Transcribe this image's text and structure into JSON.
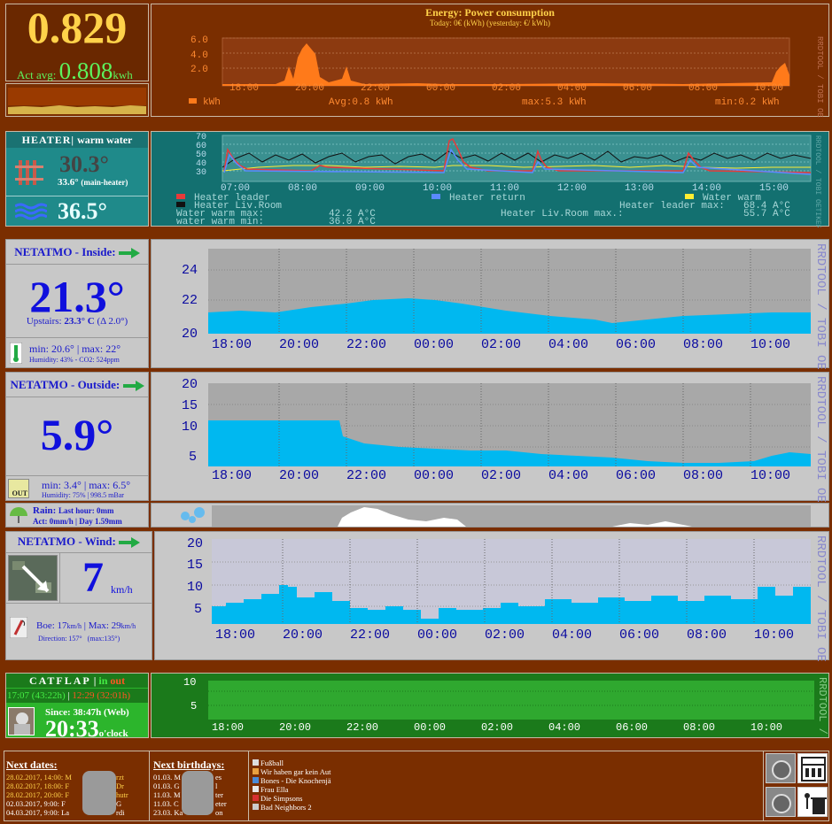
{
  "energy": {
    "current": "0.829",
    "avg_label": "Act avg:",
    "avg_value": "0.808",
    "avg_unit": "kwh",
    "graph_title": "Energy: Power consumption",
    "graph_sub": "Today: 0€ (kWh) (yesterday: €/ kWh)",
    "y_ticks": [
      "6.0",
      "4.0",
      "2.0"
    ],
    "x_ticks": [
      "18:00",
      "20:00",
      "22:00",
      "00:00",
      "02:00",
      "04:00",
      "06:00",
      "08:00",
      "10:00"
    ],
    "legend_kwh": "kWh",
    "legend_avg": "Avg:0.8 kWh",
    "legend_max": "max:5.3 kWh",
    "legend_min": "min:0.2 kWh",
    "watermark": "RRDTOOL / TOBI OETIKER",
    "color": "#ff7a1a"
  },
  "heater": {
    "title": "HEATER",
    "subtitle": "warm water",
    "temp1": "30.3°",
    "temp1_sub": "33.6°",
    "temp1_sub_note": "(main-heater)",
    "temp2": "36.5°",
    "y_ticks": [
      "70",
      "60",
      "50",
      "40",
      "30"
    ],
    "x_ticks": [
      "07:00",
      "08:00",
      "09:00",
      "10:00",
      "11:00",
      "12:00",
      "13:00",
      "14:00",
      "15:00"
    ],
    "legend": [
      {
        "label": "Heater leader",
        "color": "#e83a3a"
      },
      {
        "label": "Heater return",
        "color": "#5a8aff"
      },
      {
        "label": "Water warm",
        "color": "#ffee33"
      },
      {
        "label": "Heater Liv.Room",
        "color": "#111111"
      }
    ],
    "stat_rows": [
      [
        "Heater leader max:",
        "68.4 A°C"
      ],
      [
        "Water warm max:",
        "42.2 A°C"
      ],
      [
        "Heater Liv.Room max.:",
        "55.7 A°C"
      ],
      [
        "water warm min:",
        "36.0 A°C"
      ]
    ],
    "watermark": "RRDTOOL / TOBI OETIKER"
  },
  "inside": {
    "title": "NETATMO - Inside:",
    "temp": "21.3°",
    "upstairs_label": "Upstairs:",
    "upstairs_val": "23.3° C",
    "upstairs_delta": "(Δ 2.0°)",
    "min": "min: 20.6°",
    "max": "max: 22°",
    "humidity": "Humidity: 43%",
    "co2": "CO2: 524ppm",
    "y_ticks": [
      "24",
      "22",
      "20"
    ],
    "x_ticks": [
      "18:00",
      "20:00",
      "22:00",
      "00:00",
      "02:00",
      "04:00",
      "06:00",
      "08:00",
      "10:00"
    ],
    "watermark": "RRDTOOL / TOBI OETIKER"
  },
  "outside": {
    "title": "NETATMO - Outside:",
    "temp": "5.9°",
    "min": "min: 3.4°",
    "max": "max: 6.5°",
    "humidity": "Humidity: 75%",
    "pressure": "998.5 mBar",
    "icon_label": "OUT",
    "y_ticks": [
      "20",
      "15",
      "10",
      "5"
    ],
    "x_ticks": [
      "18:00",
      "20:00",
      "22:00",
      "00:00",
      "02:00",
      "04:00",
      "06:00",
      "08:00",
      "10:00"
    ],
    "watermark": "RRDTOOL / TOBI OETIKER"
  },
  "rain": {
    "label": "Rain:",
    "last_hour": "Last hour: 0mm",
    "act": "Act: 0mm/h",
    "day": "Day 1.59mm"
  },
  "wind": {
    "title": "NETATMO - Wind:",
    "speed": "7",
    "unit": "km/h",
    "boe_label": "Boe:",
    "boe_val": "17",
    "boe_unit": "km/h",
    "max_label": "Max:",
    "max_val": "29",
    "max_unit": "km/h",
    "direction": "Direction: 157°",
    "max_dir": "(max:135°)",
    "y_ticks": [
      "20",
      "15",
      "10",
      "5"
    ],
    "x_ticks": [
      "18:00",
      "20:00",
      "22:00",
      "00:00",
      "02:00",
      "04:00",
      "06:00",
      "08:00",
      "10:00"
    ],
    "watermark": "RRDTOOL / TOBI OETIKER"
  },
  "catflap": {
    "title": "CATFLAP",
    "sep": "|",
    "in": "in",
    "out": "out",
    "in_time": "17:07 (43:22h)",
    "out_time": "12:29 (32:01h)",
    "since": "Since: 38:47h (Web)",
    "clock": "20:33",
    "clock_unit": "o'clock",
    "y_ticks": [
      "10",
      "5"
    ],
    "x_ticks": [
      "18:00",
      "20:00",
      "22:00",
      "00:00",
      "02:00",
      "04:00",
      "06:00",
      "08:00",
      "10:00"
    ],
    "watermark": "RRDTOOL / TOBI"
  },
  "dates": {
    "title": "Next dates:",
    "items": [
      "28.02.2017, 14:00: M",
      "28.02.2017, 18:00: F",
      "28.02.2017, 20:00: F",
      "02.03.2017, 9:00: F",
      "04.03.2017, 9:00: La"
    ],
    "tails": [
      "rzt",
      "Dr",
      "hutr",
      "G",
      "rdi"
    ]
  },
  "birthdays": {
    "title": "Next birthdays:",
    "items": [
      "01.03. M",
      "01.03. G",
      "11.03. M",
      "11.03. C",
      "23.03. Ka"
    ],
    "tails": [
      "es",
      "l",
      "ter",
      "eter",
      "on"
    ]
  },
  "tv": {
    "items": [
      "Fußball",
      "Wir haben gar kein Aut",
      "Bones - Die Knochenjä",
      "Frau Ella",
      "Die Simpsons",
      "Bad Neighbors 2"
    ]
  }
}
